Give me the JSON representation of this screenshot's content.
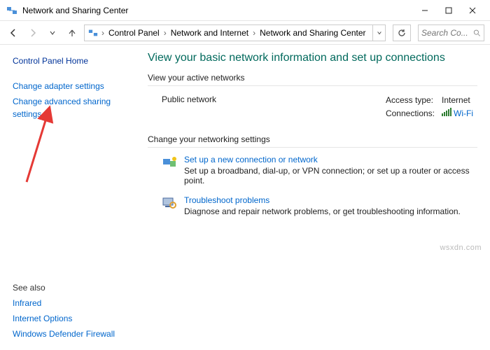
{
  "window": {
    "title": "Network and Sharing Center"
  },
  "breadcrumb": {
    "items": [
      "Control Panel",
      "Network and Internet",
      "Network and Sharing Center"
    ]
  },
  "search": {
    "placeholder": "Search Co..."
  },
  "sidebar": {
    "home": "Control Panel Home",
    "link_adapter": "Change adapter settings",
    "link_advanced": "Change advanced sharing settings",
    "see_also_head": "See also",
    "see_also": [
      "Infrared",
      "Internet Options",
      "Windows Defender Firewall"
    ]
  },
  "main": {
    "title": "View your basic network information and set up connections",
    "active_head": "View your active networks",
    "active": {
      "name": "Public network",
      "access_label": "Access type:",
      "access_value": "Internet",
      "conn_label": "Connections:",
      "conn_value": "Wi-Fi"
    },
    "change_head": "Change your networking settings",
    "item1": {
      "title": "Set up a new connection or network",
      "desc": "Set up a broadband, dial-up, or VPN connection; or set up a router or access point."
    },
    "item2": {
      "title": "Troubleshoot problems",
      "desc": "Diagnose and repair network problems, or get troubleshooting information."
    }
  },
  "watermark": "wsxdn.com"
}
